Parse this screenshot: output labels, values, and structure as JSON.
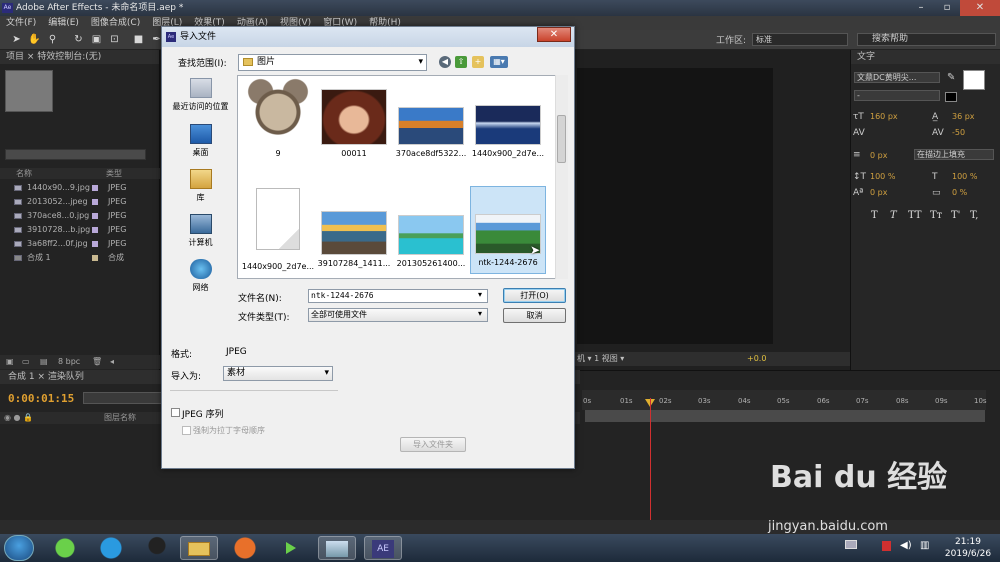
{
  "app": {
    "title": "Adobe After Effects - 未命名项目.aep *",
    "icon_text": "Ae",
    "menu": [
      "文件(F)",
      "编辑(E)",
      "图像合成(C)",
      "图层(L)",
      "效果(T)",
      "动画(A)",
      "视图(V)",
      "窗口(W)",
      "帮助(H)"
    ],
    "workspace_label": "工作区:",
    "workspace_value": "标准",
    "help_search_placeholder": "搜索帮助"
  },
  "project_panel": {
    "tabs": "项目 × 特效控制台:(无)",
    "header": {
      "name": "名称",
      "type": "类型"
    },
    "items": [
      {
        "name": "1440x90...9.jpg",
        "type": "JPEG"
      },
      {
        "name": "2013052...jpeg",
        "type": "JPEG"
      },
      {
        "name": "370ace8...0.jpg",
        "type": "JPEG"
      },
      {
        "name": "3910728...b.jpg",
        "type": "JPEG"
      },
      {
        "name": "3a68ff2...0f.jpg",
        "type": "JPEG"
      },
      {
        "name": "合成 1",
        "type": "合成"
      }
    ],
    "bpc": "8 bpc"
  },
  "viewer": {
    "bar_text": "机 ▾  1 视图 ▾",
    "offset": "+0.0"
  },
  "text_panel": {
    "tab": "文字",
    "font": "文鼎DC黄明尖...",
    "style": "-",
    "size": "160 px",
    "leading": "36 px",
    "tracking": "-50",
    "stroke": "0 px",
    "stroke_mode": "在描边上填充",
    "vscale": "100 %",
    "hscale": "100 %",
    "baseline": "0 px",
    "tsume": "0 %",
    "styles": [
      "T",
      "T",
      "TT",
      "Tт",
      "T'",
      "T,"
    ]
  },
  "timeline": {
    "tabs": "合成 1 ×  渲染队列",
    "timecode": "0:00:01:15",
    "layer_name_header": "图层名称",
    "ticks": [
      "0s",
      "01s",
      "02s",
      "03s",
      "04s",
      "05s",
      "06s",
      "07s",
      "08s",
      "09s",
      "10s"
    ]
  },
  "dialog": {
    "title": "导入文件",
    "lookin_label": "查找范围(I):",
    "lookin_value": "图片",
    "places": [
      "最近访问的位置",
      "桌面",
      "库",
      "计算机",
      "网络"
    ],
    "files": [
      {
        "name": "9",
        "thumb": "mickey"
      },
      {
        "name": "00011",
        "thumb": "girl"
      },
      {
        "name": "370ace8df5322...",
        "thumb": "mountain"
      },
      {
        "name": "1440x900_2d7e...",
        "thumb": "sea-night"
      },
      {
        "name": "1440x900_2d7e...",
        "thumb": "blank"
      },
      {
        "name": "39107284_1411...",
        "thumb": "rocks"
      },
      {
        "name": "201305261400...",
        "thumb": "island"
      },
      {
        "name": "ntk-1244-2676",
        "thumb": "hills",
        "selected": true
      }
    ],
    "filename_label": "文件名(N):",
    "filename_value": "ntk-1244-2676",
    "filetype_label": "文件类型(T):",
    "filetype_value": "全部可使用文件",
    "open_label": "打开(O)",
    "cancel_label": "取消",
    "format_label": "格式:",
    "format_value": "JPEG",
    "importas_label": "导入为:",
    "importas_value": "素材",
    "jpeg_seq_label": "JPEG 序列",
    "alpha_label": "强制为拉丁字母顺序",
    "import_folder_label": "导入文件夹"
  },
  "taskbar": {
    "time": "21:19",
    "date": "2019/6/26"
  },
  "watermark": {
    "line1": "Bai du 经验",
    "line2": "jingyan.baidu.com"
  }
}
